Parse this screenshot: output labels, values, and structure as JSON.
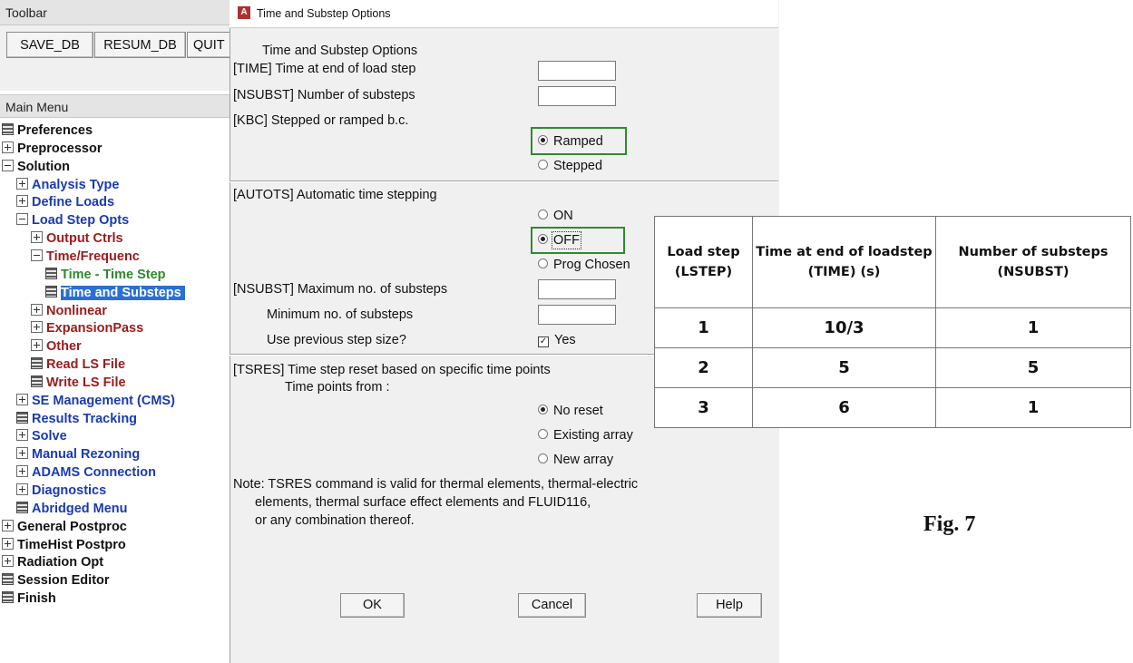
{
  "toolbar": {
    "title": "Toolbar",
    "buttons": [
      "SAVE_DB",
      "RESUM_DB",
      "QUIT"
    ]
  },
  "main_menu": {
    "title": "Main Menu",
    "items": [
      {
        "label": "Preferences",
        "icon": "command-icon",
        "color": "black"
      },
      {
        "label": "Preprocessor",
        "icon": "expand-icon",
        "color": "black"
      },
      {
        "label": "Solution",
        "icon": "collapse-icon",
        "color": "black"
      },
      {
        "label": "Analysis Type",
        "icon": "expand-icon",
        "color": "blue"
      },
      {
        "label": "Define Loads",
        "icon": "expand-icon",
        "color": "blue"
      },
      {
        "label": "Load Step Opts",
        "icon": "collapse-icon",
        "color": "blue"
      },
      {
        "label": "Output Ctrls",
        "icon": "expand-icon",
        "color": "red"
      },
      {
        "label": "Time/Frequenc",
        "icon": "collapse-icon",
        "color": "red"
      },
      {
        "label": "Time - Time Step",
        "icon": "command-icon",
        "color": "green"
      },
      {
        "label": "Time and Substeps",
        "icon": "command-icon",
        "color": "selected"
      },
      {
        "label": "Nonlinear",
        "icon": "expand-icon",
        "color": "red"
      },
      {
        "label": "ExpansionPass",
        "icon": "expand-icon",
        "color": "red"
      },
      {
        "label": "Other",
        "icon": "expand-icon",
        "color": "red"
      },
      {
        "label": "Read LS File",
        "icon": "command-icon",
        "color": "red"
      },
      {
        "label": "Write LS File",
        "icon": "command-icon",
        "color": "red"
      },
      {
        "label": "SE Management (CMS)",
        "icon": "expand-icon",
        "color": "blue"
      },
      {
        "label": "Results Tracking",
        "icon": "command-icon",
        "color": "blue"
      },
      {
        "label": "Solve",
        "icon": "expand-icon",
        "color": "blue"
      },
      {
        "label": "Manual Rezoning",
        "icon": "expand-icon",
        "color": "blue"
      },
      {
        "label": "ADAMS Connection",
        "icon": "expand-icon",
        "color": "blue"
      },
      {
        "label": "Diagnostics",
        "icon": "expand-icon",
        "color": "blue"
      },
      {
        "label": "Abridged Menu",
        "icon": "command-icon",
        "color": "blue"
      },
      {
        "label": "General Postproc",
        "icon": "expand-icon",
        "color": "black"
      },
      {
        "label": "TimeHist Postpro",
        "icon": "expand-icon",
        "color": "black"
      },
      {
        "label": "Radiation Opt",
        "icon": "expand-icon",
        "color": "black"
      },
      {
        "label": "Session Editor",
        "icon": "command-icon",
        "color": "black"
      },
      {
        "label": "Finish",
        "icon": "command-icon",
        "color": "black"
      }
    ]
  },
  "dialog": {
    "window_title": "Time and Substep Options",
    "heading": "Time and Substep Options",
    "time_label": "[TIME]  Time at end of load step",
    "time_value": "",
    "nsubst_label": "[NSUBST]  Number of substeps",
    "nsubst_value": "",
    "kbc_label": "[KBC]     Stepped or ramped b.c.",
    "kbc_options": [
      "Ramped",
      "Stepped"
    ],
    "kbc_selected": "Ramped",
    "autots_label": "[AUTOTS] Automatic time stepping",
    "autots_options": [
      "ON",
      "OFF",
      "Prog Chosen"
    ],
    "autots_selected": "OFF",
    "max_substeps_label": "[NSUBST] Maximum no. of substeps",
    "max_substeps_value": "",
    "min_substeps_label": "Minimum no. of substeps",
    "min_substeps_value": "",
    "prev_step_label": "Use previous step size?",
    "prev_step_checkbox_label": "Yes",
    "prev_step_checked": true,
    "tsres_label": "[TSRES]  Time step reset based on specific time points",
    "time_points_label": "Time points from :",
    "tsres_options": [
      "No reset",
      "Existing array",
      "New array"
    ],
    "tsres_selected": "No reset",
    "note_lines": [
      "Note: TSRES command is valid for thermal elements, thermal-electric",
      "elements, thermal surface effect elements and FLUID116,",
      "or any combination thereof."
    ],
    "buttons": {
      "ok": "OK",
      "cancel": "Cancel",
      "help": "Help"
    },
    "highlight_color": "#2e8b2e"
  },
  "load_step_table": {
    "headers": [
      [
        "Load step",
        "(LSTEP)"
      ],
      [
        "Time at end of loadstep",
        "(TIME)  (s)"
      ],
      [
        "Number of substeps",
        "(NSUBST)"
      ]
    ],
    "rows": [
      [
        "1",
        "10/3",
        "1"
      ],
      [
        "2",
        "5",
        "5"
      ],
      [
        "3",
        "6",
        "1"
      ]
    ]
  },
  "figure_caption": "Fig. 7"
}
